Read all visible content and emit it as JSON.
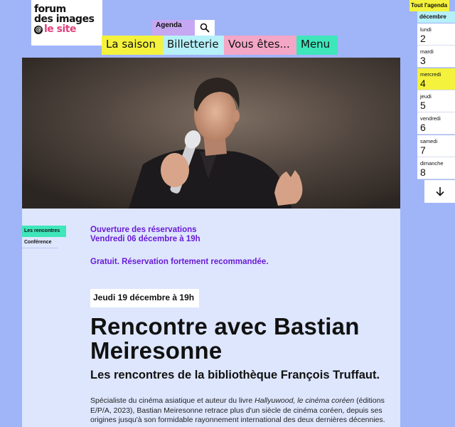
{
  "logo": {
    "line1": "forum",
    "line2": "des images",
    "line3": "le site",
    "at": "@"
  },
  "header": {
    "agenda_label": "Agenda",
    "search_icon": "search-icon",
    "nav": [
      "La saison",
      "Billetterie",
      "Vous êtes...",
      "Menu"
    ]
  },
  "hero": {
    "image": "speaker-photo"
  },
  "event": {
    "tags": [
      "Les rencontres",
      "Conférence"
    ],
    "reservation_open": "Ouverture des réservations",
    "reservation_date": "Vendredi 06 décembre à 19h",
    "price_note": "Gratuit. Réservation fortement recommandée.",
    "date": "Jeudi 19 décembre à 19h",
    "title": "Rencontre avec Bastian Meiresonne",
    "subtitle": "Les rencontres de la bibliothèque François Truffaut.",
    "desc_1": "Spécialiste du cinéma asiatique et auteur du livre ",
    "desc_book": "Hallyuwood, le cinéma coréen",
    "desc_2": " (éditions E/P/A, 2023), Bastian Meiresonne retrace plus d'un siècle de cinéma coréen, depuis ses origines jusqu'à son formidable rayonnement international des deux dernières décennies."
  },
  "agenda_side": {
    "all_label": "Tout l'agenda",
    "month": "décembre",
    "days": [
      {
        "weekday": "lundi",
        "num": "2"
      },
      {
        "weekday": "mardi",
        "num": "3"
      },
      {
        "weekday": "mercredi",
        "num": "4"
      },
      {
        "weekday": "jeudi",
        "num": "5"
      },
      {
        "weekday": "vendredi",
        "num": "6"
      },
      {
        "weekday": "samedi",
        "num": "7"
      },
      {
        "weekday": "dimanche",
        "num": "8"
      }
    ],
    "selected_index": 2,
    "next_icon": "arrow-down-icon"
  },
  "colors": {
    "background": "#a0b4f8",
    "yellow": "#f4f23c",
    "cyan": "#b6f0f8",
    "pink": "#f4a6c6",
    "green": "#3ee6ba",
    "purple": "#6a1bd6",
    "content_bg": "#dde6fd"
  }
}
